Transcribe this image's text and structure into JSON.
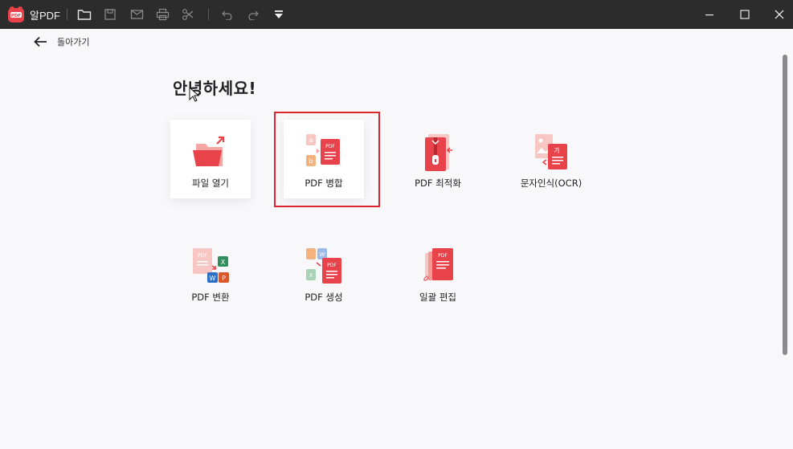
{
  "titlebar": {
    "app_name": "알PDF",
    "toolbar_icons": [
      "folder-open-icon",
      "save-icon",
      "mail-icon",
      "print-icon",
      "scissors-icon",
      "undo-icon",
      "redo-icon",
      "dropdown-menu-icon"
    ],
    "window_controls": [
      "minimize-icon",
      "maximize-icon",
      "close-icon"
    ]
  },
  "nav": {
    "back_label": "돌아가기"
  },
  "main": {
    "greeting": "안녕하세요!",
    "tiles": [
      {
        "label": "파일 열기",
        "icon": "open-folder-icon"
      },
      {
        "label": "PDF 병합",
        "icon": "pdf-merge-icon"
      },
      {
        "label": "PDF 최적화",
        "icon": "pdf-optimize-icon"
      },
      {
        "label": "문자인식(OCR)",
        "icon": "ocr-icon"
      },
      {
        "label": "PDF 변환",
        "icon": "pdf-convert-icon"
      },
      {
        "label": "PDF 생성",
        "icon": "pdf-create-icon"
      },
      {
        "label": "일괄 편집",
        "icon": "batch-edit-icon"
      }
    ],
    "highlighted_tile": "PDF 병합"
  },
  "colors": {
    "accent": "#e8424a",
    "highlight_border": "#d9262f",
    "titlebar": "#2c2c2c"
  }
}
